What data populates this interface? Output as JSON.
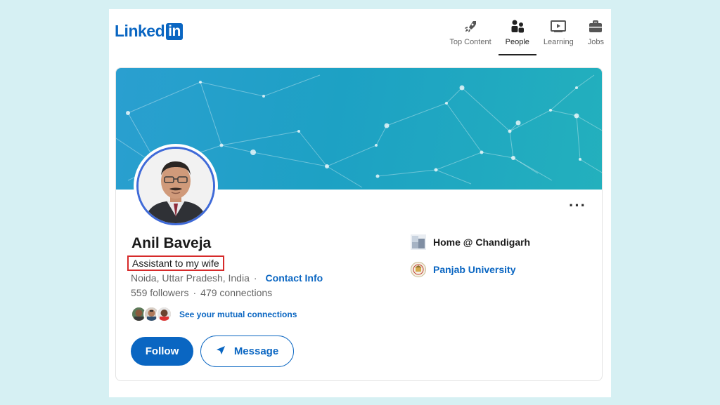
{
  "header": {
    "logo_text": "Linked",
    "logo_box": "in",
    "nav": [
      {
        "label": "Top Content",
        "icon": "rocket-icon"
      },
      {
        "label": "People",
        "icon": "people-icon",
        "active": true
      },
      {
        "label": "Learning",
        "icon": "play-icon"
      },
      {
        "label": "Jobs",
        "icon": "briefcase-icon"
      }
    ]
  },
  "profile": {
    "name": "Anil Baveja",
    "headline": "Assistant to my wife",
    "location": "Noida, Uttar Pradesh, India",
    "separator": "·",
    "contact_info": "Contact Info",
    "followers": "559 followers",
    "connections": "479 connections",
    "mutual_link": "See your mutual connections",
    "more_icon": "···",
    "follow_label": "Follow",
    "message_label": "Message",
    "workplace": "Home @ Chandigarh",
    "school": "Panjab University"
  },
  "colors": {
    "brand": "#0a66c2",
    "highlight": "#d62a2a"
  }
}
